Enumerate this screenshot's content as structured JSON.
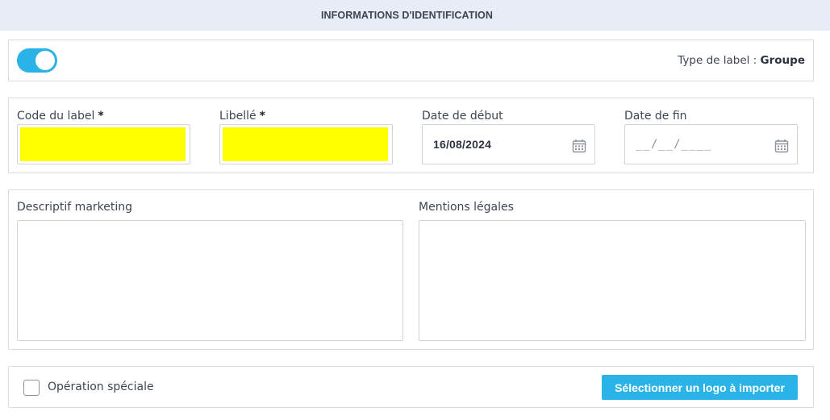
{
  "header": {
    "title": "INFORMATIONS D'IDENTIFICATION"
  },
  "top": {
    "toggle_on": true,
    "type_label_prefix": "Type de label :",
    "type_label_value": "Groupe"
  },
  "fields": {
    "code": {
      "label": "Code du label",
      "required": "*",
      "value": ""
    },
    "libelle": {
      "label": "Libellé",
      "required": "*",
      "value": ""
    },
    "date_debut": {
      "label": "Date de début",
      "value": "16/08/2024"
    },
    "date_fin": {
      "label": "Date de fin",
      "placeholder": "__/__/____"
    }
  },
  "text_areas": {
    "descriptif": {
      "label": "Descriptif marketing",
      "value": ""
    },
    "mentions": {
      "label": "Mentions légales",
      "value": ""
    }
  },
  "bottom": {
    "checkbox_label": "Opération spéciale",
    "checked": false,
    "logo_button": "Sélectionner un logo à importer"
  },
  "colors": {
    "accent": "#29b3e6",
    "highlight": "#ffff00",
    "header_bg": "#e8ecf4"
  },
  "icons": [
    "calendar-icon"
  ]
}
